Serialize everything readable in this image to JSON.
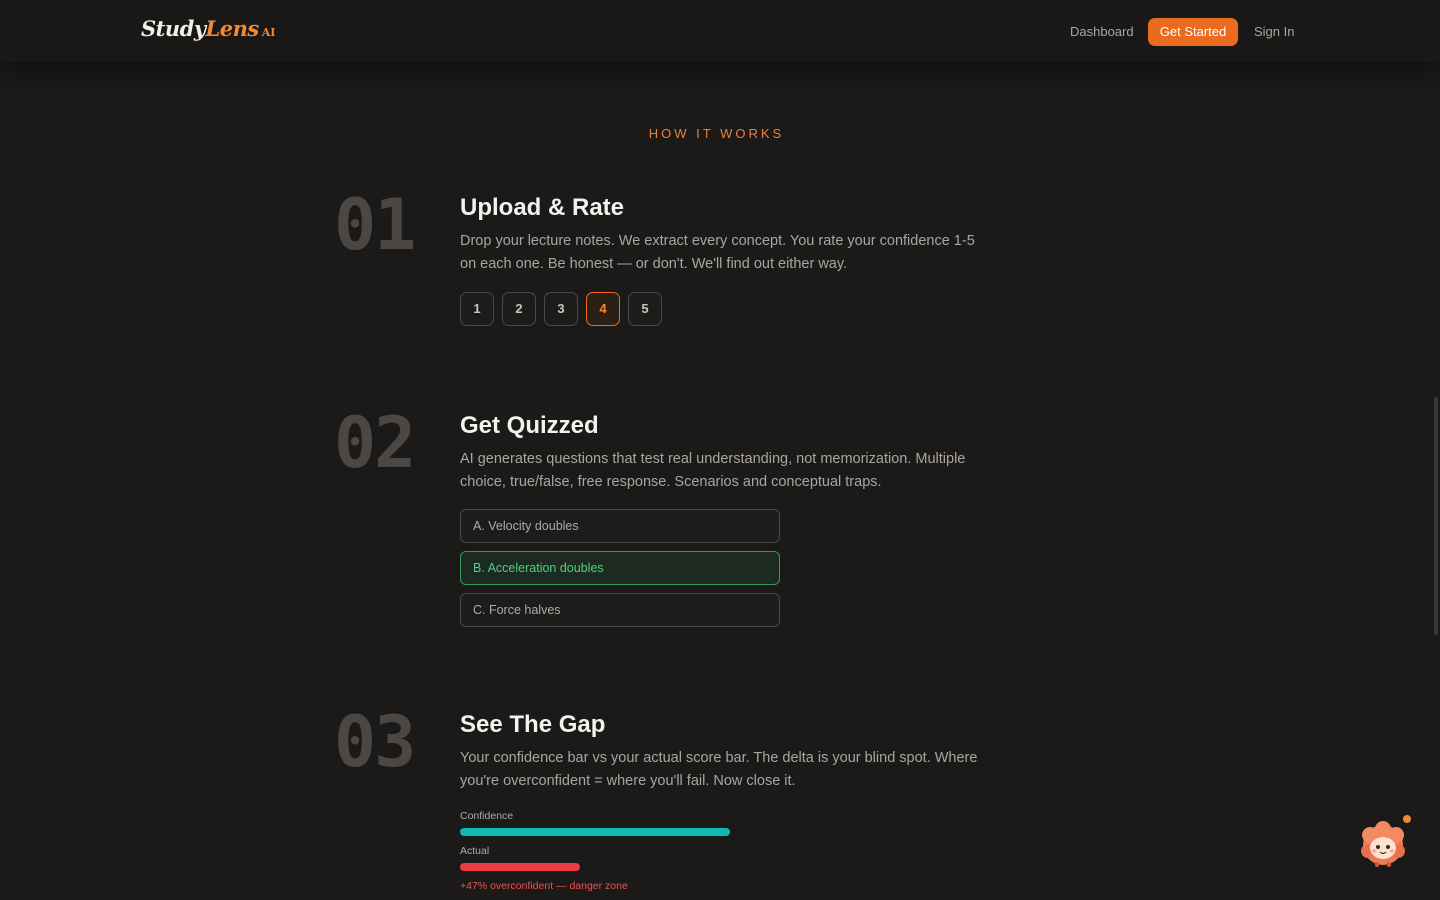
{
  "header": {
    "logo_study": "Study",
    "logo_lens": "Lens",
    "logo_ai": "AI",
    "nav_dashboard": "Dashboard",
    "nav_get_started": "Get Started",
    "nav_sign_in": "Sign In"
  },
  "section": {
    "eyebrow": "HOW IT WORKS"
  },
  "steps": [
    {
      "number": "01",
      "title": "Upload & Rate",
      "description": "Drop your lecture notes. We extract every concept. You rate your confidence 1-5 on each one. Be honest — or don't. We'll find out either way.",
      "ratings": [
        "1",
        "2",
        "3",
        "4",
        "5"
      ],
      "selected_rating": "4"
    },
    {
      "number": "02",
      "title": "Get Quizzed",
      "description": "AI generates questions that test real understanding, not memorization. Multiple choice, true/false, free response. Scenarios and conceptual traps.",
      "options": [
        "A. Velocity doubles",
        "B. Acceleration doubles",
        "C. Force halves"
      ],
      "correct_option": "B. Acceleration doubles"
    },
    {
      "number": "03",
      "title": "See The Gap",
      "description": "Your confidence bar vs your actual score bar. The delta is your blind spot. Where you're overconfident = where you'll fail. Now close it.",
      "confidence_label": "Confidence",
      "actual_label": "Actual",
      "gap_note": "+47% overconfident — danger zone"
    }
  ],
  "bars": {
    "confidence_fraction": 0.52,
    "actual_fraction": 0.23,
    "confidence_color": "#12b8b8",
    "actual_color": "#ee3b45"
  },
  "colors": {
    "accent": "#ea6a1e",
    "correct": "#4fd083",
    "background": "#1c1a19"
  },
  "widgets": {
    "mascot_icon": "sheep-mascot-icon"
  }
}
